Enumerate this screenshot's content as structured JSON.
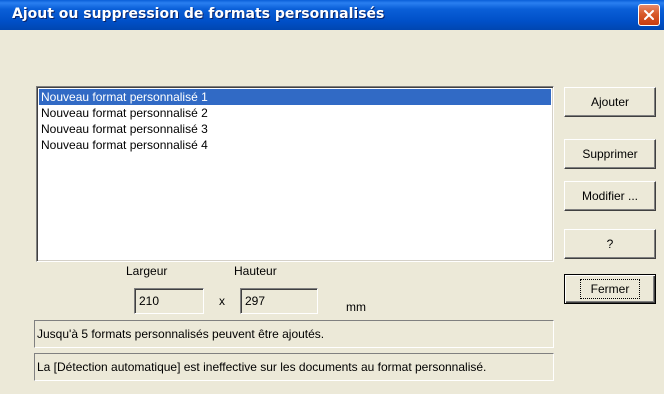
{
  "window": {
    "title": "Ajout ou suppression de formats personnalisés"
  },
  "list": {
    "items": [
      {
        "label": "Nouveau format personnalisé 1",
        "selected": true
      },
      {
        "label": "Nouveau format personnalisé 2",
        "selected": false
      },
      {
        "label": "Nouveau format personnalisé 3",
        "selected": false
      },
      {
        "label": "Nouveau format personnalisé 4",
        "selected": false
      }
    ]
  },
  "dimensions": {
    "width_label": "Largeur",
    "height_label": "Hauteur",
    "width_value": "210",
    "height_value": "297",
    "separator": "x",
    "unit": "mm"
  },
  "buttons": {
    "add": "Ajouter",
    "delete": "Supprimer",
    "modify": "Modifier ...",
    "help": "?",
    "close": "Fermer"
  },
  "info": {
    "line1": "Jusqu'à 5 formats personnalisés peuvent être ajoutés.",
    "line2": "La [Détection automatique] est ineffective sur les documents au format personnalisé."
  },
  "icons": {
    "close": "close-icon"
  }
}
